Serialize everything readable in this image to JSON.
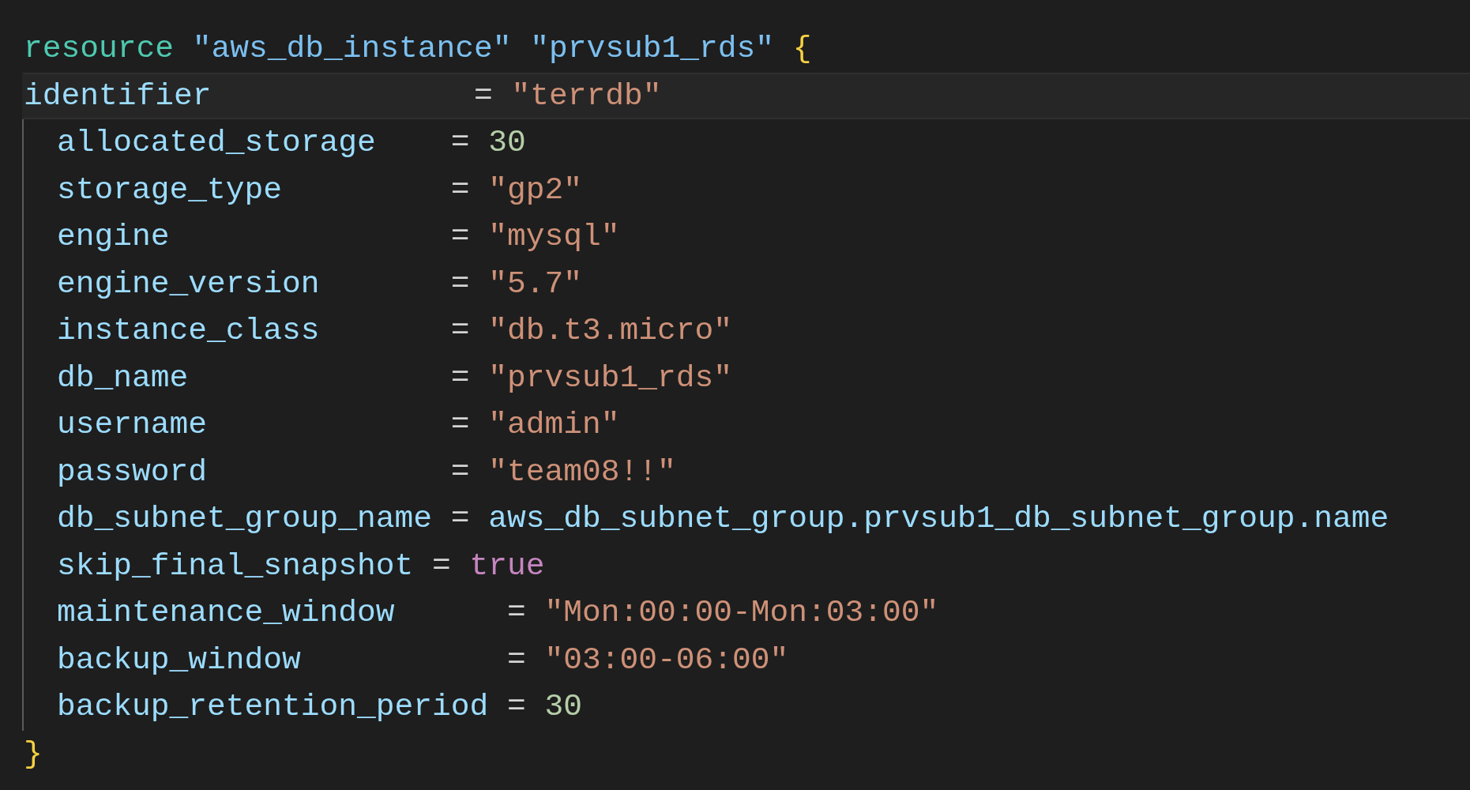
{
  "header": [
    {
      "kind": "keyword",
      "text": "resource"
    },
    {
      "kind": "label",
      "text": " \"aws_db_instance\""
    },
    {
      "kind": "label",
      "text": " \"prvsub1_rds\""
    },
    {
      "kind": "brace",
      "text": " {"
    }
  ],
  "body": [
    {
      "indented": false,
      "highlighted": true,
      "tokens": [
        {
          "kind": "attr",
          "text": "identifier"
        },
        {
          "kind": "op",
          "text": "              = "
        },
        {
          "kind": "string",
          "text": "\"terrdb\""
        }
      ]
    },
    {
      "indented": true,
      "highlighted": false,
      "tokens": [
        {
          "kind": "attr",
          "text": "allocated_storage"
        },
        {
          "kind": "op",
          "text": "    = "
        },
        {
          "kind": "number",
          "text": "30"
        }
      ]
    },
    {
      "indented": true,
      "highlighted": false,
      "tokens": [
        {
          "kind": "attr",
          "text": "storage_type"
        },
        {
          "kind": "op",
          "text": "         = "
        },
        {
          "kind": "string",
          "text": "\"gp2\""
        }
      ]
    },
    {
      "indented": true,
      "highlighted": false,
      "tokens": [
        {
          "kind": "attr",
          "text": "engine"
        },
        {
          "kind": "op",
          "text": "               = "
        },
        {
          "kind": "string",
          "text": "\"mysql\""
        }
      ]
    },
    {
      "indented": true,
      "highlighted": false,
      "tokens": [
        {
          "kind": "attr",
          "text": "engine_version"
        },
        {
          "kind": "op",
          "text": "       = "
        },
        {
          "kind": "string",
          "text": "\"5.7\""
        }
      ]
    },
    {
      "indented": true,
      "highlighted": false,
      "tokens": [
        {
          "kind": "attr",
          "text": "instance_class"
        },
        {
          "kind": "op",
          "text": "       = "
        },
        {
          "kind": "string",
          "text": "\"db.t3.micro\""
        }
      ]
    },
    {
      "indented": true,
      "highlighted": false,
      "tokens": [
        {
          "kind": "attr",
          "text": "db_name"
        },
        {
          "kind": "op",
          "text": "              = "
        },
        {
          "kind": "string",
          "text": "\"prvsub1_rds\""
        }
      ]
    },
    {
      "indented": true,
      "highlighted": false,
      "tokens": [
        {
          "kind": "attr",
          "text": "username"
        },
        {
          "kind": "op",
          "text": "             = "
        },
        {
          "kind": "string",
          "text": "\"admin\""
        }
      ]
    },
    {
      "indented": true,
      "highlighted": false,
      "tokens": [
        {
          "kind": "attr",
          "text": "password"
        },
        {
          "kind": "op",
          "text": "             = "
        },
        {
          "kind": "string",
          "text": "\"team08!!\""
        }
      ]
    },
    {
      "indented": true,
      "highlighted": false,
      "tokens": [
        {
          "kind": "attr",
          "text": "db_subnet_group_name"
        },
        {
          "kind": "op",
          "text": " = "
        },
        {
          "kind": "attr",
          "text": "aws_db_subnet_group.prvsub1_db_subnet_group.name"
        }
      ]
    },
    {
      "indented": true,
      "highlighted": false,
      "tokens": [
        {
          "kind": "attr",
          "text": "skip_final_snapshot"
        },
        {
          "kind": "op",
          "text": " = "
        },
        {
          "kind": "bool",
          "text": "true"
        }
      ]
    },
    {
      "indented": true,
      "highlighted": false,
      "tokens": [
        {
          "kind": "attr",
          "text": "maintenance_window"
        },
        {
          "kind": "op",
          "text": "      = "
        },
        {
          "kind": "string",
          "text": "\"Mon:00:00-Mon:03:00\""
        }
      ]
    },
    {
      "indented": true,
      "highlighted": false,
      "tokens": [
        {
          "kind": "attr",
          "text": "backup_window"
        },
        {
          "kind": "op",
          "text": "           = "
        },
        {
          "kind": "string",
          "text": "\"03:00-06:00\""
        }
      ]
    },
    {
      "indented": true,
      "highlighted": false,
      "tokens": [
        {
          "kind": "attr",
          "text": "backup_retention_period"
        },
        {
          "kind": "op",
          "text": " = "
        },
        {
          "kind": "number",
          "text": "30"
        }
      ]
    }
  ],
  "footer": [
    {
      "kind": "brace",
      "text": "}"
    }
  ]
}
